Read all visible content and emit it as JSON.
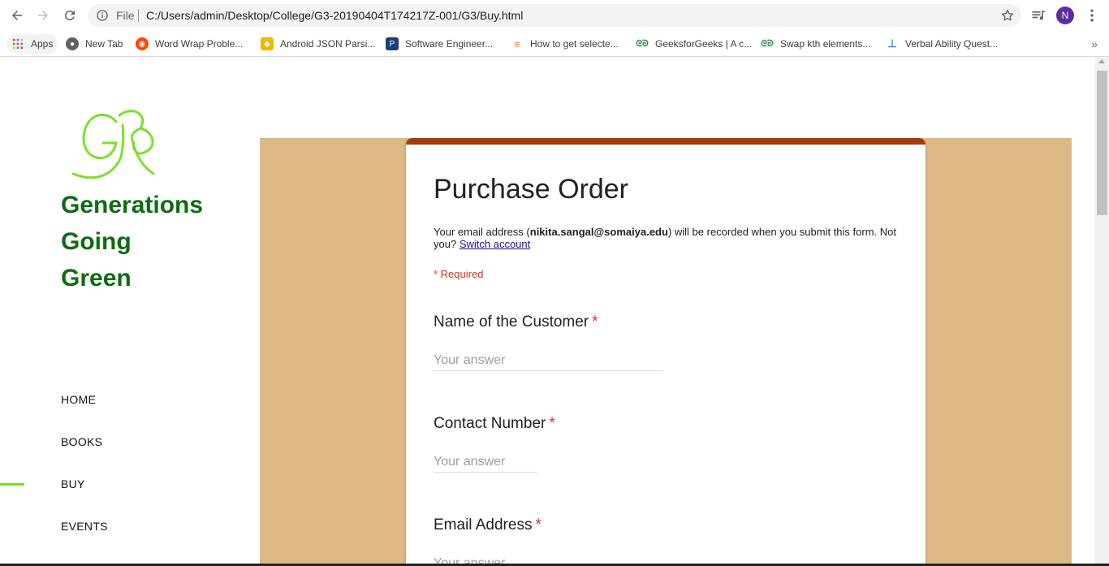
{
  "browser": {
    "omnibox_scheme": "File",
    "url": "C:/Users/admin/Desktop/College/G3-20190404T174217Z-001/G3/Buy.html",
    "profile_initial": "N",
    "bookmarks": [
      {
        "label": "Apps",
        "icon": "apps-grid-icon",
        "color": "#4285f4"
      },
      {
        "label": "New Tab",
        "icon": "globe-icon",
        "color": "#5f6368"
      },
      {
        "label": "Word Wrap Proble...",
        "icon": "reddit-icon",
        "color": "#ff4500"
      },
      {
        "label": "Android JSON Parsi...",
        "icon": "bookmark-yellow-icon",
        "color": "#f4b400"
      },
      {
        "label": "Software Engineer...",
        "icon": "p-badge-icon",
        "color": "#1a3d7c"
      },
      {
        "label": "How to get selecte...",
        "icon": "stackoverflow-icon",
        "color": "#f48024"
      },
      {
        "label": "GeeksforGeeks | A c...",
        "icon": "gfg-icon",
        "color": "#2f8d46"
      },
      {
        "label": "Swap kth elements...",
        "icon": "gfg-icon",
        "color": "#2f8d46"
      },
      {
        "label": "Verbal Ability Quest...",
        "icon": "indiabix-icon",
        "color": "#1e88e5"
      }
    ]
  },
  "site": {
    "brand_lines": [
      "Generations",
      "Going",
      "Green"
    ],
    "brand_color": "#0f6b12",
    "accent_color": "#7be02b",
    "nav": [
      "HOME",
      "BOOKS",
      "BUY",
      "EVENTS"
    ],
    "active_nav": "BUY"
  },
  "form": {
    "title": "Purchase Order",
    "email_prefix": "Your email address (",
    "email": "nikita.sangal@somaiya.edu",
    "email_suffix": ") will be recorded when you submit this form. Not you? ",
    "switch_account": "Switch account",
    "required_note": "* Required",
    "background_color": "#deb887",
    "header_color": "#a13d0a",
    "questions": [
      {
        "label": "Name of the Customer",
        "star": "*",
        "placeholder": "Your answer"
      },
      {
        "label": "Contact Number",
        "star": "*",
        "placeholder": "Your answer"
      },
      {
        "label": "Email Address",
        "star": "*",
        "placeholder": "Your answer"
      }
    ]
  }
}
